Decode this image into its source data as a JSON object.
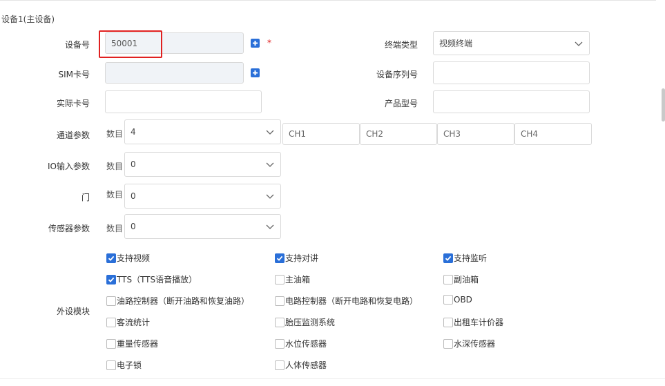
{
  "section_title": "设备1(主设备)",
  "fields": {
    "device_no": {
      "label": "设备号",
      "value": "50001"
    },
    "sim_no": {
      "label": "SIM卡号",
      "value": ""
    },
    "actual_card": {
      "label": "实际卡号",
      "value": ""
    },
    "terminal_type": {
      "label": "终端类型",
      "value": "视频终端"
    },
    "serial_no": {
      "label": "设备序列号",
      "value": ""
    },
    "product_model": {
      "label": "产品型号",
      "value": ""
    },
    "channel_params": {
      "label": "通道参数",
      "count_label": "数目",
      "count": "4",
      "channels": [
        "CH1",
        "CH2",
        "CH3",
        "CH4"
      ]
    },
    "io_input": {
      "label": "IO输入参数",
      "count_label": "数目",
      "count": "0"
    },
    "door": {
      "label": "门",
      "count_label": "数目",
      "count": "0"
    },
    "sensor_params": {
      "label": "传感器参数",
      "count_label": "数目",
      "count": "0"
    }
  },
  "required_mark": "*",
  "peripherals": {
    "label": "外设模块",
    "items": [
      {
        "text": "支持视频",
        "checked": true
      },
      {
        "text": "支持对讲",
        "checked": true
      },
      {
        "text": "支持监听",
        "checked": true
      },
      {
        "text": "TTS（TTS语音播放）",
        "checked": true
      },
      {
        "text": "主油箱",
        "checked": false
      },
      {
        "text": "副油箱",
        "checked": false
      },
      {
        "text": "油路控制器（断开油路和恢复油路）",
        "checked": false
      },
      {
        "text": "电路控制器（断开电路和恢复电路）",
        "checked": false
      },
      {
        "text": "OBD",
        "checked": false
      },
      {
        "text": "客流统计",
        "checked": false
      },
      {
        "text": "胎压监测系统",
        "checked": false
      },
      {
        "text": "出租车计价器",
        "checked": false
      },
      {
        "text": "重量传感器",
        "checked": false
      },
      {
        "text": "水位传感器",
        "checked": false
      },
      {
        "text": "水深传感器",
        "checked": false
      },
      {
        "text": "电子锁",
        "checked": false
      },
      {
        "text": "人体传感器",
        "checked": false
      }
    ]
  },
  "colors": {
    "accent": "#2a6fd8",
    "highlight_border": "#e02020"
  }
}
